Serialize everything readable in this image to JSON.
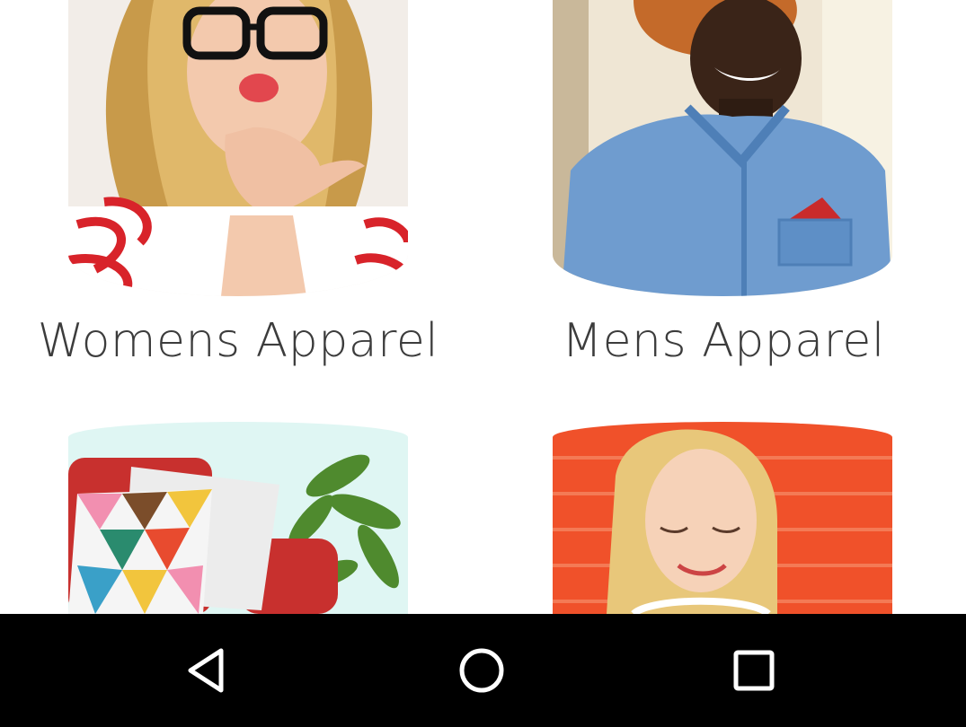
{
  "categories": [
    {
      "label": "Womens Apparel",
      "image": "woman-blowing-kiss-photo"
    },
    {
      "label": "Mens Apparel",
      "image": "man-in-denim-shirt-photo"
    },
    {
      "label": "",
      "image": "home-decor-pillows-photo"
    },
    {
      "label": "",
      "image": "woman-with-headphones-photo"
    }
  ],
  "navbar": {
    "back": "back-icon",
    "home": "home-icon",
    "recents": "recents-icon"
  }
}
